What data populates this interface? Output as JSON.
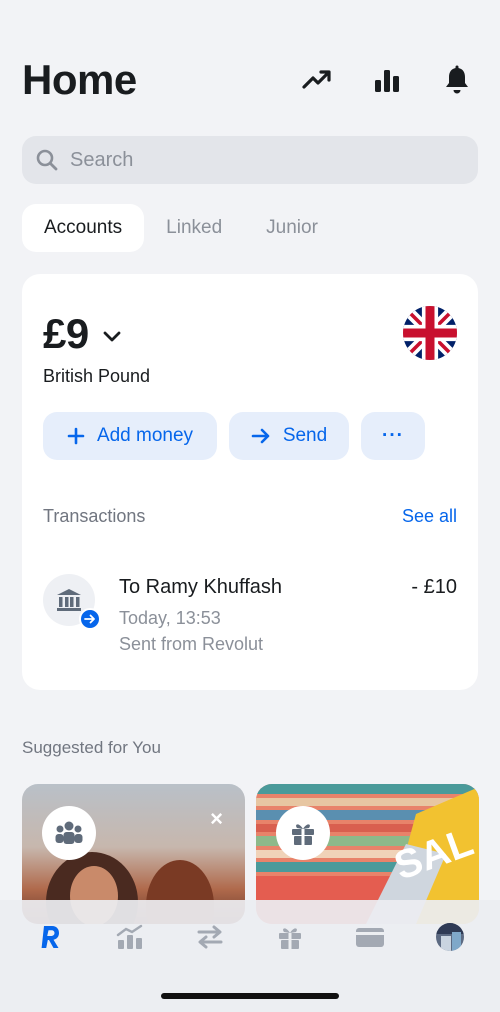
{
  "header": {
    "title": "Home",
    "icons": [
      "trend-icon",
      "bar-chart-icon",
      "bell-icon"
    ]
  },
  "search": {
    "placeholder": "Search"
  },
  "tabs": [
    {
      "label": "Accounts",
      "active": true
    },
    {
      "label": "Linked",
      "active": false
    },
    {
      "label": "Junior",
      "active": false
    }
  ],
  "account": {
    "balance": "£9",
    "currency_name": "British Pound",
    "flag": "uk-flag-icon",
    "actions": {
      "add_money": "Add money",
      "send": "Send",
      "more": "···"
    }
  },
  "transactions": {
    "label": "Transactions",
    "see_all": "See all",
    "items": [
      {
        "title": "To Ramy Khuffash",
        "time": "Today, 13:53",
        "subtitle": "Sent from Revolut",
        "amount": "- £10"
      }
    ]
  },
  "suggested": {
    "title": "Suggested for You",
    "close": "×"
  },
  "tabbar": {
    "items": [
      "revolut-home-icon",
      "wealth-icon",
      "transfers-icon",
      "rewards-icon",
      "cards-icon",
      "profile-avatar"
    ]
  },
  "colors": {
    "accent": "#0666eb",
    "background": "#f2f3f6",
    "card": "#ffffff",
    "muted": "#8b9099"
  }
}
